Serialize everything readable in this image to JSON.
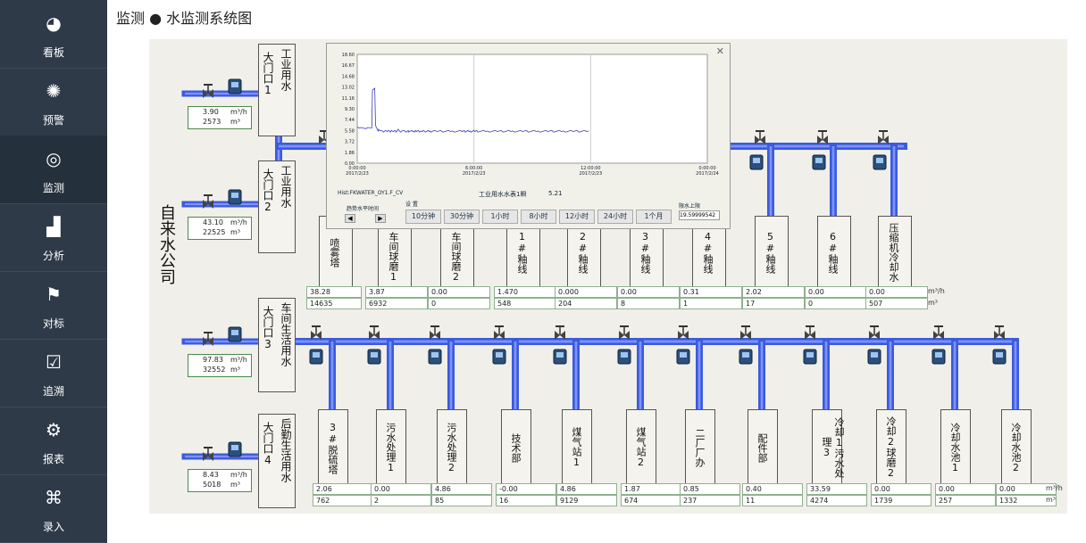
{
  "page_title": "监测 ● 水监测系统图",
  "nav": [
    {
      "label": "看板",
      "icon": "pie-chart-icon"
    },
    {
      "label": "预警",
      "icon": "alarm-light-icon"
    },
    {
      "label": "监测",
      "icon": "monitor-icon"
    },
    {
      "label": "分析",
      "icon": "analysis-chart-icon"
    },
    {
      "label": "对标",
      "icon": "flag-icon"
    },
    {
      "label": "追溯",
      "icon": "checklist-icon"
    },
    {
      "label": "报表",
      "icon": "report-icon"
    },
    {
      "label": "录入",
      "icon": "command-icon"
    }
  ],
  "source": "自来水公司",
  "gates": [
    {
      "gate": "大门口1",
      "usage": "工业用水",
      "rate": "3.90",
      "total": "2573"
    },
    {
      "gate": "大门口2",
      "usage": "工业用水",
      "rate": "43.10",
      "total": "22525"
    },
    {
      "gate": "大门口3",
      "usage": "车间生活用水",
      "rate": "97.83",
      "total": "32552"
    },
    {
      "gate": "大门口4",
      "usage": "后勤生活用水",
      "rate": "8.43",
      "total": "5018"
    }
  ],
  "units": {
    "rate": "m³/h",
    "total": "m³"
  },
  "top_branches": [
    {
      "name": "喷雾塔",
      "rate": "38.28",
      "total": "14635"
    },
    {
      "name": "一车间球磨1",
      "rate": "3.87",
      "total": "6932"
    },
    {
      "name": "一车间球磨2",
      "rate": "0.00",
      "total": "0"
    },
    {
      "name": "1#釉线",
      "rate": "1.470",
      "total": "548"
    },
    {
      "name": "2#釉线",
      "rate": "0.000",
      "total": "204"
    },
    {
      "name": "3#釉线",
      "rate": "0.00",
      "total": "8"
    },
    {
      "name": "4#釉线",
      "rate": "0.31",
      "total": "1"
    },
    {
      "name": "5#釉线",
      "rate": "2.02",
      "total": "17"
    },
    {
      "name": "6#釉线",
      "rate": "0.00",
      "total": "0"
    },
    {
      "name": "压缩机冷却水",
      "rate": "0.00",
      "total": "507"
    }
  ],
  "bottom_branches": [
    {
      "name": "3#脱硫塔",
      "rate": "2.06",
      "total": "762"
    },
    {
      "name": "污水处理1",
      "rate": "0.00",
      "total": "2"
    },
    {
      "name": "污水处理2",
      "rate": "4.86",
      "total": "85"
    },
    {
      "name": "技术部",
      "rate": "-0.00",
      "total": "16"
    },
    {
      "name": "煤气站1",
      "rate": "4.86",
      "total": "9129"
    },
    {
      "name": "煤气站2",
      "rate": "1.87",
      "total": "674"
    },
    {
      "name": "二厂厂办",
      "rate": "0.85",
      "total": "237"
    },
    {
      "name": "配件部",
      "rate": "0.40",
      "total": "11"
    },
    {
      "name": "冷却1污水处理3",
      "rate": "33.59",
      "total": "4274"
    },
    {
      "name": "冷却2球磨2",
      "rate": "0.00",
      "total": "1739"
    },
    {
      "name": "冷却水池1",
      "rate": "0.00",
      "total": "257"
    },
    {
      "name": "冷却水池2",
      "rate": "0.00",
      "total": "1332"
    }
  ],
  "popup": {
    "close": "✕",
    "tag": "Hist:FKWATER_OY1.F_CV",
    "meter_name": "工业用水水表1瞬",
    "meter_value": "5.21",
    "scroll_label": "趋势水平时间",
    "setting_label": "设 置",
    "buttons": [
      "10分钟",
      "30分钟",
      "1小时",
      "8小时",
      "12小时",
      "24小时",
      "1个月"
    ],
    "limit_label": "限水上限",
    "limit_value": "19.59999542",
    "chart_data": {
      "type": "line",
      "y_ticks": [
        "18.60",
        "16.67",
        "14.68",
        "13.02",
        "11.16",
        "9.30",
        "7.44",
        "5.58",
        "3.72",
        "1.86",
        "0.00"
      ],
      "ylim": [
        0,
        18.6
      ],
      "x_ticks": [
        [
          "0:00:00",
          "2017/2/23"
        ],
        [
          "6:00:00",
          "2017/2/23"
        ],
        [
          "12:00:00",
          "2017/2/23"
        ],
        [
          "0:00:00",
          "2017/2/24"
        ]
      ],
      "x": [
        0,
        0.1,
        0.2,
        0.3,
        0.45,
        0.5,
        0.55,
        0.75,
        0.78,
        0.9,
        0.94,
        0.97,
        1.0,
        1.03,
        1.06,
        1.08,
        1.1,
        1.13,
        1.3,
        1.35,
        1.45,
        1.5,
        1.55,
        1.6,
        1.65,
        1.7,
        1.75,
        1.85,
        1.9,
        1.95,
        2.0,
        2.05,
        2.1,
        2.15,
        2.2,
        2.25,
        2.3,
        2.35,
        2.45,
        2.5,
        2.55,
        2.6,
        2.62,
        2.65,
        2.68,
        2.75,
        2.8,
        2.85,
        2.9,
        2.95,
        3.0,
        3.05,
        3.1,
        3.15,
        3.2,
        3.3,
        3.35,
        3.4,
        3.45,
        3.5,
        3.55,
        3.6,
        3.65,
        3.7,
        3.75,
        3.8,
        3.85,
        3.9,
        4.0,
        4.1,
        4.2,
        4.3,
        4.4,
        4.5,
        4.6,
        4.7,
        4.8,
        4.9,
        5.0,
        5.1,
        5.2,
        5.3,
        5.4,
        5.45,
        5.5,
        5.55,
        5.6,
        5.65,
        5.7,
        5.75,
        5.8,
        5.85,
        5.9,
        5.95,
        6.0,
        6.05,
        6.1,
        6.15,
        6.2,
        6.3,
        6.4,
        6.5,
        6.6,
        6.7,
        6.8,
        6.9,
        7.0,
        7.1,
        7.2,
        7.3,
        7.4,
        7.5,
        7.6,
        7.7,
        7.8,
        7.9,
        8.0,
        8.1,
        8.2,
        8.3,
        8.4,
        8.5,
        8.6,
        8.7,
        8.8,
        8.9,
        9.0,
        9.1,
        9.2,
        9.3,
        9.4,
        9.5,
        9.6,
        9.7,
        9.8,
        9.9,
        10.0,
        10.1,
        10.2,
        10.3,
        10.4,
        10.5,
        10.6,
        10.7,
        10.8,
        10.9,
        11.0,
        11.1,
        11.2,
        11.3,
        11.4,
        11.5,
        11.6,
        11.7,
        11.8,
        11.9,
        12.0
      ],
      "y": [
        6.2,
        6.0,
        6.1,
        6.0,
        5.9,
        6.0,
        6.1,
        6.0,
        12.5,
        12.8,
        6.5,
        6.2,
        6.0,
        5.8,
        5.6,
        5.5,
        5.8,
        5.6,
        5.5,
        5.3,
        5.6,
        5.5,
        5.4,
        5.6,
        5.5,
        5.3,
        5.6,
        5.4,
        5.5,
        5.6,
        5.3,
        5.5,
        5.8,
        5.6,
        5.4,
        5.3,
        5.5,
        5.6,
        5.5,
        5.3,
        5.4,
        5.5,
        5.6,
        5.3,
        5.4,
        5.5,
        5.6,
        5.4,
        5.5,
        5.3,
        5.6,
        5.4,
        5.5,
        5.6,
        5.3,
        5.5,
        5.4,
        5.6,
        5.5,
        5.3,
        5.4,
        5.5,
        5.6,
        5.4,
        5.5,
        5.3,
        5.4,
        5.5,
        5.6,
        5.4,
        5.5,
        5.6,
        5.3,
        5.4,
        5.5,
        5.6,
        5.4,
        5.5,
        5.3,
        5.4,
        5.5,
        5.6,
        5.4,
        5.5,
        5.6,
        5.3,
        5.4,
        5.5,
        5.6,
        5.4,
        5.5,
        5.3,
        5.4,
        5.5,
        5.6,
        5.4,
        5.5,
        5.6,
        5.3,
        5.4,
        5.5,
        5.6,
        5.4,
        5.5,
        5.3,
        5.4,
        5.5,
        5.6,
        5.4,
        5.5,
        5.6,
        5.3,
        5.4,
        5.5,
        5.6,
        5.4,
        5.5,
        5.3,
        5.4,
        5.5,
        5.6,
        5.4,
        5.5,
        5.6,
        5.3,
        5.4,
        5.5,
        5.6,
        5.4,
        5.5,
        5.3,
        5.4,
        5.5,
        5.6,
        5.4,
        5.5,
        5.6,
        5.3,
        5.4,
        5.5,
        5.6,
        5.4,
        5.5,
        5.3,
        5.4,
        5.5,
        5.6,
        5.4,
        5.5,
        5.6,
        5.3,
        5.4,
        5.5,
        5.6,
        5.4,
        5.5
      ]
    }
  }
}
